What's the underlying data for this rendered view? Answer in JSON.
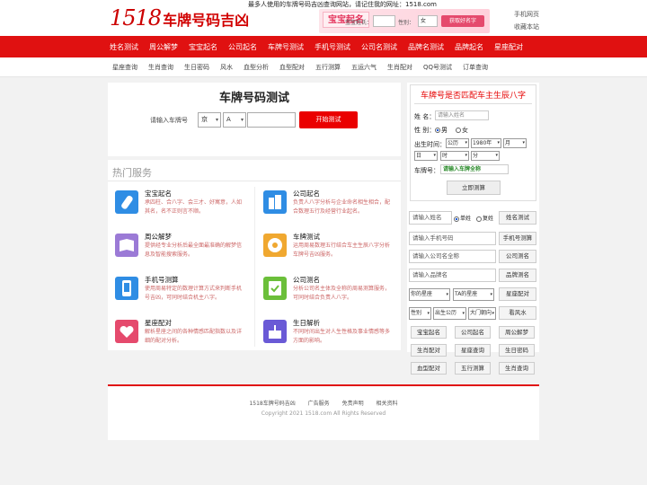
{
  "header": {
    "logo_num": "1518",
    "logo_title": "车牌号码吉凶",
    "slogan": "最多人使用的车牌号码吉凶查询网站，请记住我的网址：1518.com",
    "banner": {
      "badge": "宝宝起名",
      "name_label": "宝宝姓氏：",
      "gender_label": "性别：",
      "gender_value": "女",
      "button": "获取好名字"
    },
    "links": [
      "手机网页",
      "收藏本站"
    ]
  },
  "nav_main": [
    "姓名测试",
    "周公解梦",
    "宝宝起名",
    "公司起名",
    "车牌号测试",
    "手机号测试",
    "公司名测试",
    "品牌名测试",
    "品牌起名",
    "星座配对"
  ],
  "nav_sub": [
    "星座查询",
    "生肖查询",
    "生日密码",
    "风水",
    "血型分析",
    "血型配对",
    "五行测算",
    "五运六气",
    "生肖配对",
    "QQ号测试",
    "订单查询"
  ],
  "plate_test": {
    "title": "车牌号码测试",
    "label": "请输入车牌号",
    "province": "京",
    "letter": "A",
    "number_value": "",
    "button": "开始测试"
  },
  "hot": {
    "title": "热门服务",
    "items": [
      {
        "name": "宝宝起名",
        "desc": "承四柱、合八字、会三才、好寓意，人如其名，名不正则言不顺。",
        "icon": "baby-bottle-icon",
        "color": "#2f8de4"
      },
      {
        "name": "公司起名",
        "desc": "负责人八字分析与企业命名相生相合，配合数理五行及经营行业起名。",
        "icon": "building-icon",
        "color": "#2f8de4"
      },
      {
        "name": "周公解梦",
        "desc": "提供经专业分析后最全面最准确的解梦信息及智能搜索服务。",
        "icon": "book-icon",
        "color": "#9b7ad6"
      },
      {
        "name": "车牌测试",
        "desc": "运用周易数理五行结合车主生辰八字分析车牌号吉凶服务。",
        "icon": "bagua-icon",
        "color": "#f0a830"
      },
      {
        "name": "手机号测算",
        "desc": "使用周易特定的数理计算方式来判断手机号吉凶，可同时结合机主八字。",
        "icon": "phone-icon",
        "color": "#2f8de4"
      },
      {
        "name": "公司测名",
        "desc": "分析公司名主体及全称的周易测算服务，可同时结合负责人八字。",
        "icon": "notebook-icon",
        "color": "#6bbf3a"
      },
      {
        "name": "星座配对",
        "desc": "解析星座之间的各种情感匹配指数以及详细的配对分析。",
        "icon": "hearts-icon",
        "color": "#e54a6d"
      },
      {
        "name": "生日解析",
        "desc": "不同时间出生对人生性格及事业情感等多方面的影响。",
        "icon": "cake-icon",
        "color": "#6a5ad6"
      }
    ]
  },
  "bazi": {
    "title": "车牌号是否匹配车主生辰八字",
    "name_label": "姓 名：",
    "name_placeholder": "请输入姓名",
    "gender_label": "性 别：",
    "male": "男",
    "female": "女",
    "birth_label": "出生时间：",
    "calendar": "公历",
    "year": "1980年",
    "month": "月",
    "day": "日",
    "hour": "时",
    "minute": "分",
    "plate_label": "车牌号：",
    "plate_placeholder": "请输入车牌全称",
    "submit": "立即测算"
  },
  "quick": {
    "name_placeholder": "请输入姓名",
    "single": "单姓",
    "double": "复姓",
    "name_btn": "姓名测试",
    "phone_placeholder": "请输入手机号码",
    "phone_btn": "手机号测算",
    "company_placeholder": "请输入公司名全称",
    "company_btn": "公司测名",
    "brand_placeholder": "请输入品牌名",
    "brand_btn": "品牌测名",
    "your_sign": "你的星座",
    "ta_sign": "TA的星座",
    "sign_btn": "星座配对",
    "gender": "性别",
    "birth_year": "出生公历",
    "direction": "大门朝向",
    "fengshui_btn": "看风水",
    "grid": [
      "宝宝起名",
      "公司起名",
      "周公解梦",
      "生肖配对",
      "星座查询",
      "生日密码",
      "血型配对",
      "五行测算",
      "生肖查询"
    ]
  },
  "footer": {
    "links": [
      "1518车牌号码吉凶",
      "广告服务",
      "免责声明",
      "相关资料"
    ],
    "copyright": "Copyright 2021 1518.com All Rights Reserved"
  }
}
